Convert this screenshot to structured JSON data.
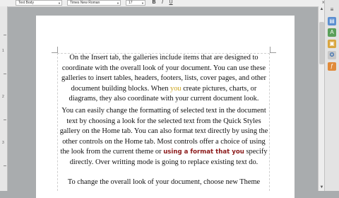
{
  "toolbar": {
    "paragraph_style": "Text Body",
    "font_name": "Times New Roman",
    "font_size": "17"
  },
  "ruler": {
    "marks": [
      "1",
      "2",
      "3"
    ]
  },
  "document": {
    "para1_a": "On the Insert tab, the galleries include items that are designed to coordinate with the overall look of your document. You can use these galleries to insert tables, headers, footers, lists, cover pages, and other document building blocks. When ",
    "para1_cursor": "you",
    "para1_b": " create pictures, charts, or diagrams, they also coordinate with your current document look.",
    "para2_a": "You can easily change the formatting of selected text in the document text by choosing a look for the selected text from the Quick Styles gallery on the Home tab. You can also format text directly by using the other controls on the Home tab. Most controls offer a choice of using the look from the current theme or ",
    "para2_styled": "using a format that you",
    "para2_b": " specify directly. Over writting mode is going to replace existing text do.",
    "para3": "To change the overall look of your document, choose new Theme"
  },
  "sidebar": {
    "icons": [
      "properties-icon",
      "styles-icon",
      "gallery-icon",
      "navigator-icon",
      "functions-icon"
    ]
  },
  "colors": {
    "cursor_highlight": "#c9a21a",
    "styled_text": "#8b1a1a"
  }
}
